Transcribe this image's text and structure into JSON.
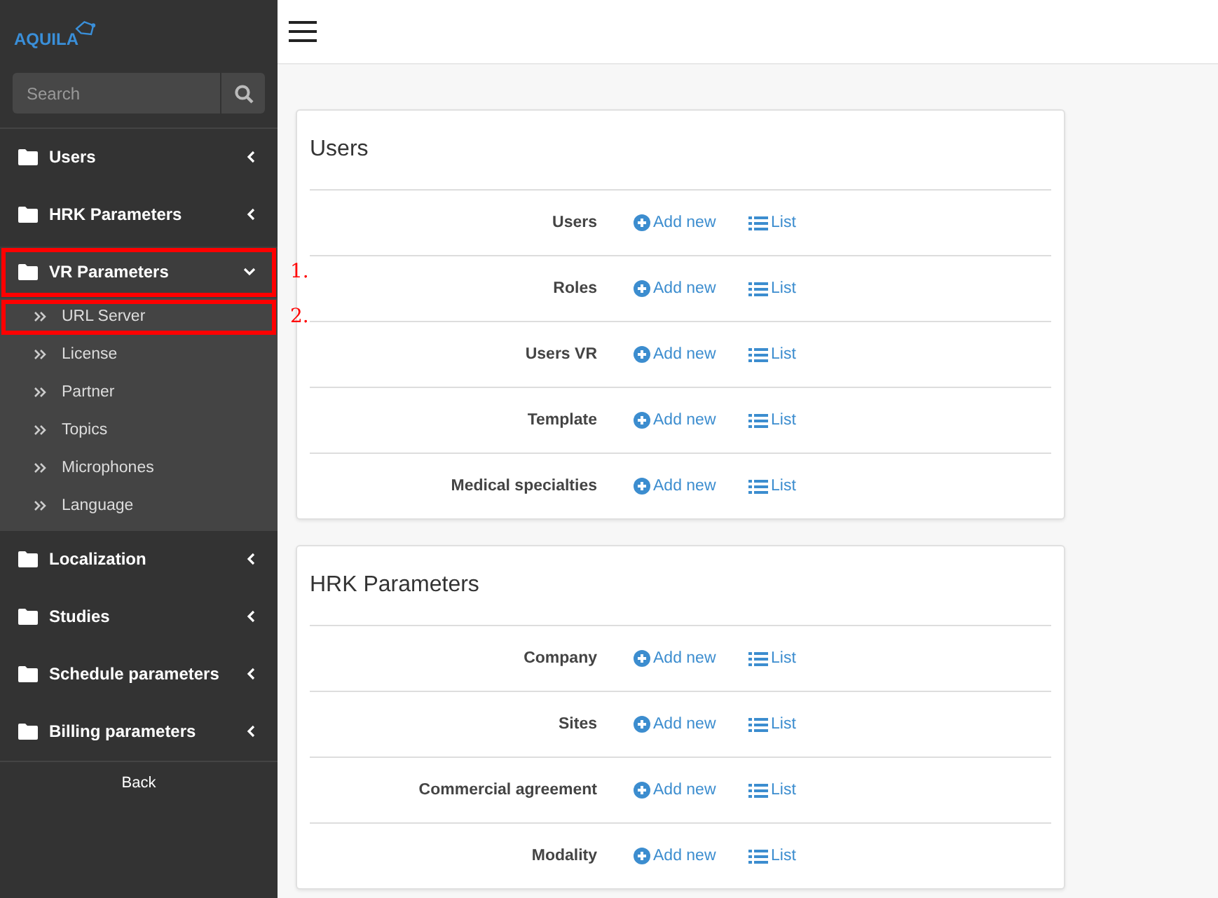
{
  "logo": {
    "text": "AQUILA"
  },
  "search": {
    "placeholder": "Search"
  },
  "sidebar": {
    "items": [
      {
        "label": "Users",
        "expanded": false
      },
      {
        "label": "HRK Parameters",
        "expanded": false
      },
      {
        "label": "VR Parameters",
        "expanded": true,
        "annotation": "1.",
        "children": [
          {
            "label": "URL Server",
            "annotation": "2."
          },
          {
            "label": "License"
          },
          {
            "label": "Partner"
          },
          {
            "label": "Topics"
          },
          {
            "label": "Microphones"
          },
          {
            "label": "Language"
          }
        ]
      },
      {
        "label": "Localization",
        "expanded": false
      },
      {
        "label": "Studies",
        "expanded": false
      },
      {
        "label": "Schedule parameters",
        "expanded": false
      },
      {
        "label": "Billing parameters",
        "expanded": false
      }
    ],
    "back": "Back"
  },
  "cards": [
    {
      "title": "Users",
      "rows": [
        {
          "label": "Users",
          "add": "Add new",
          "list": "List"
        },
        {
          "label": "Roles",
          "add": "Add new",
          "list": "List"
        },
        {
          "label": "Users VR",
          "add": "Add new",
          "list": "List"
        },
        {
          "label": "Template",
          "add": "Add new",
          "list": "List"
        },
        {
          "label": "Medical specialties",
          "add": "Add new",
          "list": "List"
        }
      ]
    },
    {
      "title": "HRK Parameters",
      "rows": [
        {
          "label": "Company",
          "add": "Add new",
          "list": "List"
        },
        {
          "label": "Sites",
          "add": "Add new",
          "list": "List"
        },
        {
          "label": "Commercial agreement",
          "add": "Add new",
          "list": "List"
        },
        {
          "label": "Modality",
          "add": "Add new",
          "list": "List"
        }
      ]
    }
  ]
}
